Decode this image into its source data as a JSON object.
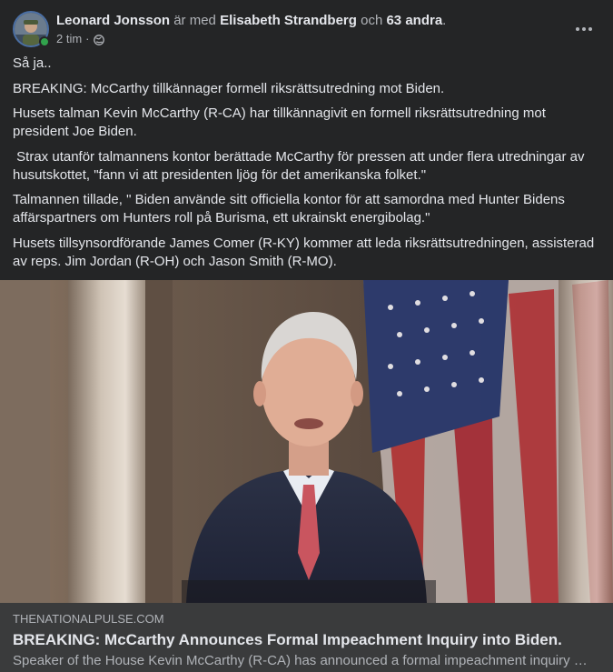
{
  "post": {
    "author": "Leonard Jonsson",
    "with_text": "är med",
    "tagged": "Elisabeth Strandberg",
    "and_text": "och",
    "others": "63 andra",
    "period": ".",
    "time": "2 tim",
    "separator": "·",
    "privacy_icon": "globe-icon",
    "more_icon": "more-options-icon",
    "paragraphs": [
      "Så ja..",
      "BREAKING: McCarthy tillkännager formell riksrättsutredning mot Biden.",
      "Husets talman Kevin McCarthy (R-CA) har tillkännagivit en formell riksrättsutredning mot president Joe Biden.",
      " Strax utanför talmannens kontor berättade McCarthy för pressen att under flera utredningar av husutskottet, \"fann vi att presidenten ljög för det amerikanska folket.\"",
      "Talmannen tillade, \" Biden använde sitt officiella kontor för att samordna med Hunter Bidens affärspartners om Hunters roll på Burisma, ett ukrainskt energibolag.\"",
      "Husets tillsynsordförande James Comer (R-KY) kommer att leda riksrättsutredningen, assisterad av reps. Jim Jordan (R-OH) och Jason Smith (R-MO)."
    ]
  },
  "link": {
    "domain": "THENATIONALPULSE.COM",
    "title": "BREAKING: McCarthy Announces Formal Impeachment Inquiry into Biden.",
    "description": "Speaker of the House Kevin McCarthy (R-CA) has announced a formal impeachment inquiry …"
  },
  "colors": {
    "background": "#242526",
    "card": "#3a3b3c",
    "text_primary": "#e4e6eb",
    "text_secondary": "#b0b3b8",
    "online": "#31a24c"
  }
}
